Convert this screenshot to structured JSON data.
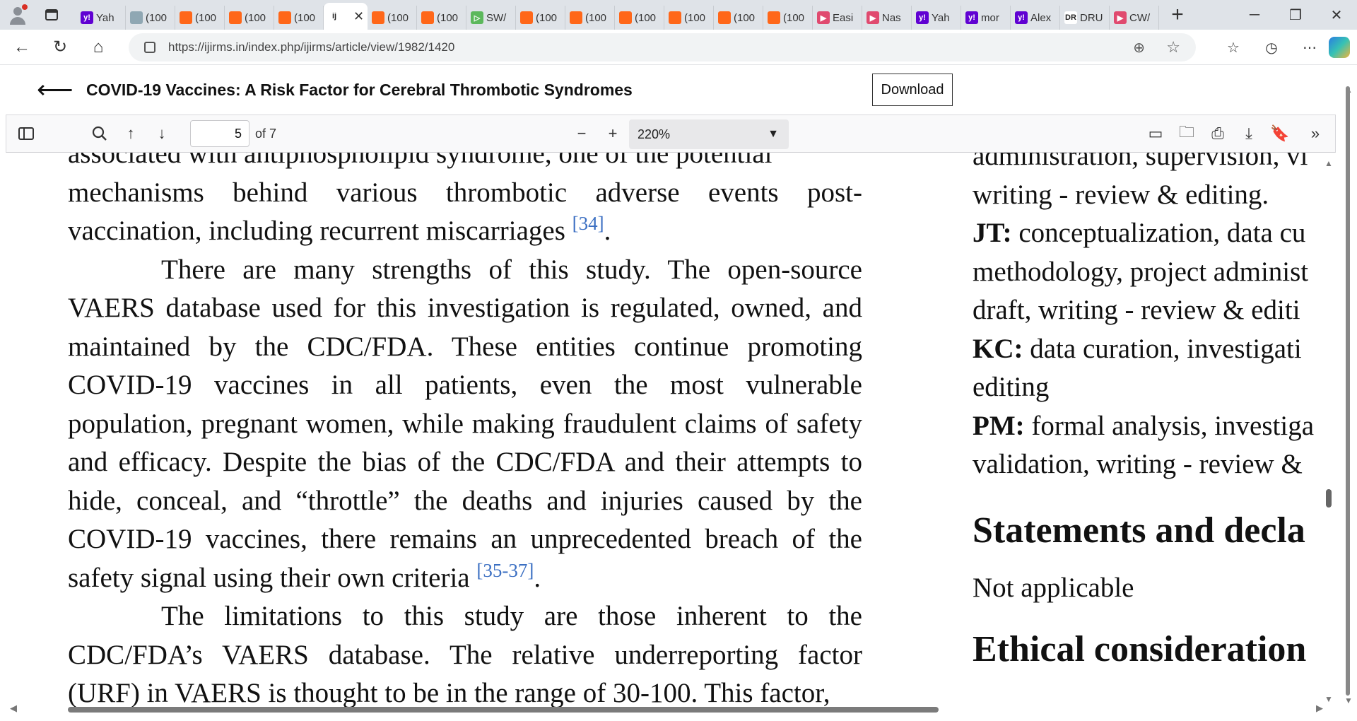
{
  "browser": {
    "tabs": [
      {
        "label": "Yah",
        "icon": "yahoo-icon",
        "color": "#6001d2",
        "glyph": "y!"
      },
      {
        "label": "(100",
        "icon": "globe-icon",
        "color": "#8fa7b3",
        "glyph": ""
      },
      {
        "label": "(100",
        "icon": "substack-icon",
        "color": "#ff6719",
        "glyph": ""
      },
      {
        "label": "(100",
        "icon": "substack-icon",
        "color": "#ff6719",
        "glyph": ""
      },
      {
        "label": "(100",
        "icon": "substack-icon",
        "color": "#ff6719",
        "glyph": ""
      },
      {
        "label": "",
        "icon": "journal-icon",
        "color": "#ffffff",
        "glyph": "ij",
        "active": true
      },
      {
        "label": "(100",
        "icon": "substack-icon",
        "color": "#ff6719",
        "glyph": ""
      },
      {
        "label": "(100",
        "icon": "substack-icon",
        "color": "#ff6719",
        "glyph": ""
      },
      {
        "label": "SW/",
        "icon": "play-icon",
        "color": "#5cb85c",
        "glyph": "▷"
      },
      {
        "label": "(100",
        "icon": "substack-icon",
        "color": "#ff6719",
        "glyph": ""
      },
      {
        "label": "(100",
        "icon": "substack-icon",
        "color": "#ff6719",
        "glyph": ""
      },
      {
        "label": "(100",
        "icon": "substack-icon",
        "color": "#ff6719",
        "glyph": ""
      },
      {
        "label": "(100",
        "icon": "substack-icon",
        "color": "#ff6719",
        "glyph": ""
      },
      {
        "label": "(100",
        "icon": "substack-icon",
        "color": "#ff6719",
        "glyph": ""
      },
      {
        "label": "(100",
        "icon": "substack-icon",
        "color": "#ff6719",
        "glyph": ""
      },
      {
        "label": "Easi",
        "icon": "video-icon",
        "color": "#e04a6f",
        "glyph": "▶"
      },
      {
        "label": "Nas",
        "icon": "video-icon",
        "color": "#e04a6f",
        "glyph": "▶"
      },
      {
        "label": "Yah",
        "icon": "yahoo-icon",
        "color": "#6001d2",
        "glyph": "y!"
      },
      {
        "label": "mor",
        "icon": "yahoo-icon",
        "color": "#6001d2",
        "glyph": "y!"
      },
      {
        "label": "Alex",
        "icon": "yahoo-icon",
        "color": "#6001d2",
        "glyph": "y!"
      },
      {
        "label": "DRU",
        "icon": "drudge-icon",
        "color": "#ffffff",
        "glyph": "DR"
      },
      {
        "label": "CW/",
        "icon": "video-icon",
        "color": "#e04a6f",
        "glyph": "▶"
      }
    ],
    "url": "https://ijirms.in/index.php/ijirms/article/view/1982/1420"
  },
  "article": {
    "title": "COVID-19 Vaccines: A Risk Factor for Cerebral Thrombotic Syndromes",
    "download_label": "Download"
  },
  "pdf_toolbar": {
    "page_current": "5",
    "page_total": "of 7",
    "zoom": "220%"
  },
  "document": {
    "col1_cut_line": "associated with antiphospholipid syndrome, one of the potential",
    "col1_p1": "mechanisms behind various thrombotic adverse events post-vaccination, including recurrent miscarriages",
    "col1_p1_ref": "[34]",
    "col1_p2": "There are many strengths of this study. The open-source VAERS database used for this investigation is regulated, owned, and maintained by the CDC/FDA. These entities continue promoting COVID-19 vaccines in all patients, even the most vulnerable population, pregnant women, while making fraudulent claims of safety and efficacy. Despite the bias of the CDC/FDA and their attempts to hide, conceal, and “throttle” the deaths and injuries caused by the COVID-19 vaccines, there remains an unprecedented breach of the safety signal using their own criteria",
    "col1_p2_ref": "[35-37]",
    "col1_p3": "The limitations to this study are those inherent to the CDC/FDA’s VAERS database. The relative underreporting factor (URF) in VAERS is thought to be in the range of 30-100. This factor,",
    "col2_cut_line": "administration, supervision, vi",
    "col2_line1": "writing - review & editing.",
    "col2_jt_label": "JT:",
    "col2_jt_text1": " conceptualization, data cu",
    "col2_jt_text2": "methodology, project administ",
    "col2_jt_text3": "draft, writing - review & editi",
    "col2_kc_label": "KC:",
    "col2_kc_text1": " data curation, investigati",
    "col2_kc_text2": "editing",
    "col2_pm_label": "PM:",
    "col2_pm_text1": " formal analysis, investiga",
    "col2_pm_text2": "validation, writing - review &",
    "col2_heading1": "Statements and decla",
    "col2_na": "Not applicable",
    "col2_heading2": "Ethical consideration"
  }
}
